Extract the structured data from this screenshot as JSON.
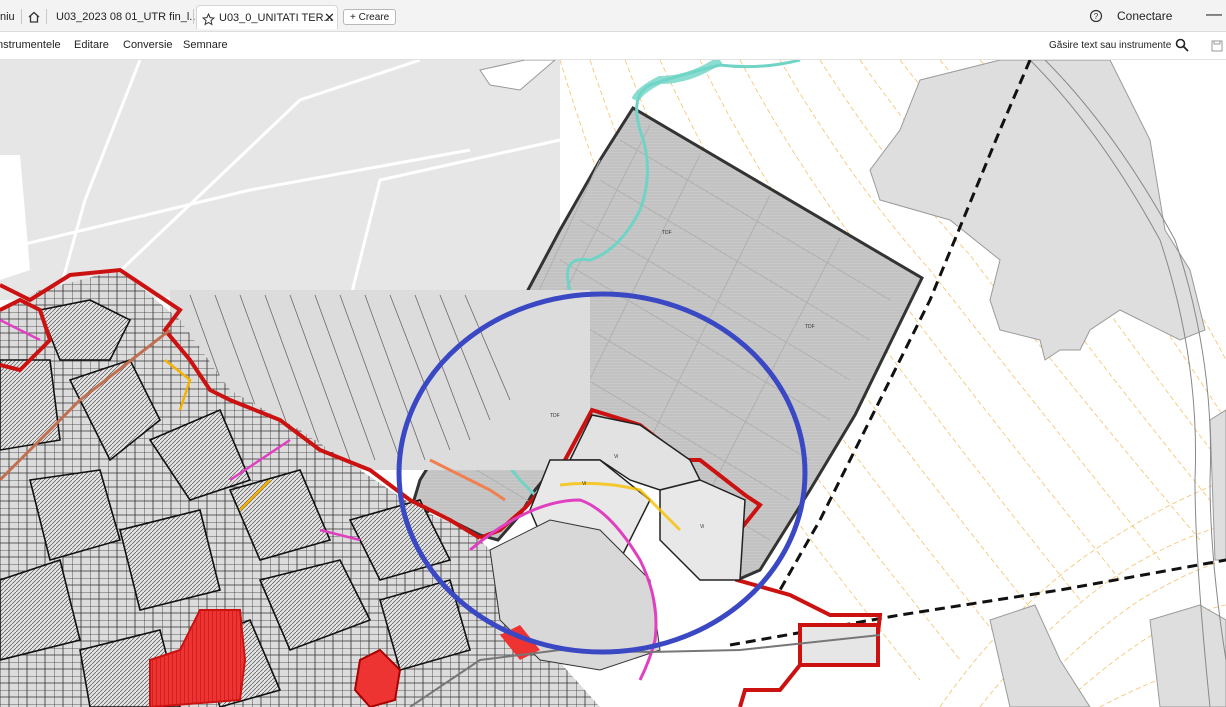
{
  "tabs": [
    {
      "label": "niu"
    },
    {
      "label": "U03_2023 08 01_UTR fin_l..."
    },
    {
      "label": "U03_0_UNITATI TER..."
    }
  ],
  "create_button": {
    "label": "+ Creare"
  },
  "account": {
    "login_label": "Conectare"
  },
  "menu": {
    "items": [
      "Instrumentele",
      "Editare",
      "Conversie",
      "Semnare"
    ]
  },
  "search": {
    "label": "Găsire text sau instrumente"
  },
  "colors": {
    "highlight_circle": "#3b48c4",
    "utr_boundary": "#cc1111",
    "railway": "#111111",
    "stream": "#5fd3c4"
  },
  "map_labels": [
    "TDF",
    "TDF",
    "TDF",
    "Vi",
    "Vi",
    "Vi"
  ]
}
